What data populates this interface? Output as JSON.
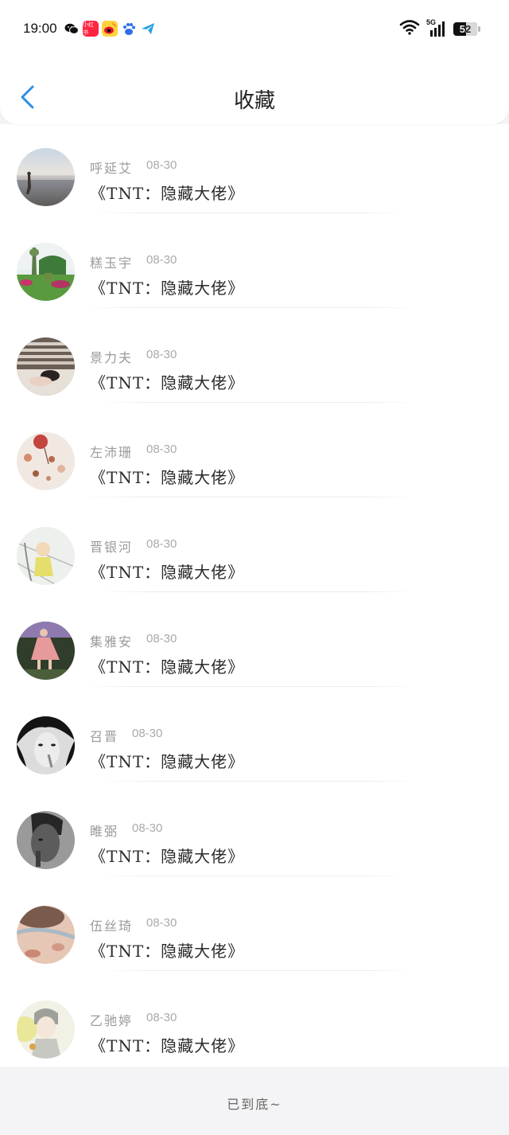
{
  "status_bar": {
    "time": "19:00",
    "network": "5G",
    "battery": "52",
    "apps": [
      {
        "icon": "wechat-icon",
        "label": "",
        "color": "#111111"
      },
      {
        "icon": "xiaohongshu-icon",
        "label": "小红书",
        "color": "#ff2442"
      },
      {
        "icon": "weibo-icon",
        "label": "",
        "color": "#f5b400"
      },
      {
        "icon": "baidu-icon",
        "label": "",
        "color": "#2f6fe6"
      },
      {
        "icon": "telegram-icon",
        "label": "",
        "color": "#2aa3e0"
      }
    ]
  },
  "header": {
    "title": "收藏",
    "back_icon": "chevron-left-icon",
    "accent": "#2d8fe6"
  },
  "items": [
    {
      "name": "呼延艾",
      "date": "08-30",
      "title": "《TNT：隐藏大佬》",
      "avatar": "beach"
    },
    {
      "name": "糕玉宇",
      "date": "08-30",
      "title": "《TNT：隐藏大佬》",
      "avatar": "garden"
    },
    {
      "name": "景力夫",
      "date": "08-30",
      "title": "《TNT：隐藏大佬》",
      "avatar": "sleeping-person"
    },
    {
      "name": "左沛珊",
      "date": "08-30",
      "title": "《TNT：隐藏大佬》",
      "avatar": "craft-table"
    },
    {
      "name": "晋银河",
      "date": "08-30",
      "title": "《TNT：隐藏大佬》",
      "avatar": "child"
    },
    {
      "name": "集雅安",
      "date": "08-30",
      "title": "《TNT：隐藏大佬》",
      "avatar": "pink-dress"
    },
    {
      "name": "召晋",
      "date": "08-30",
      "title": "《TNT：隐藏大佬》",
      "avatar": "bw-portrait"
    },
    {
      "name": "睢弼",
      "date": "08-30",
      "title": "《TNT：隐藏大佬》",
      "avatar": "man-portrait"
    },
    {
      "name": "伍丝琦",
      "date": "08-30",
      "title": "《TNT：隐藏大佬》",
      "avatar": "closeup-face"
    },
    {
      "name": "乙驰婷",
      "date": "08-30",
      "title": "《TNT：隐藏大佬》",
      "avatar": "anime"
    }
  ],
  "footer": {
    "text": "已到底~"
  }
}
